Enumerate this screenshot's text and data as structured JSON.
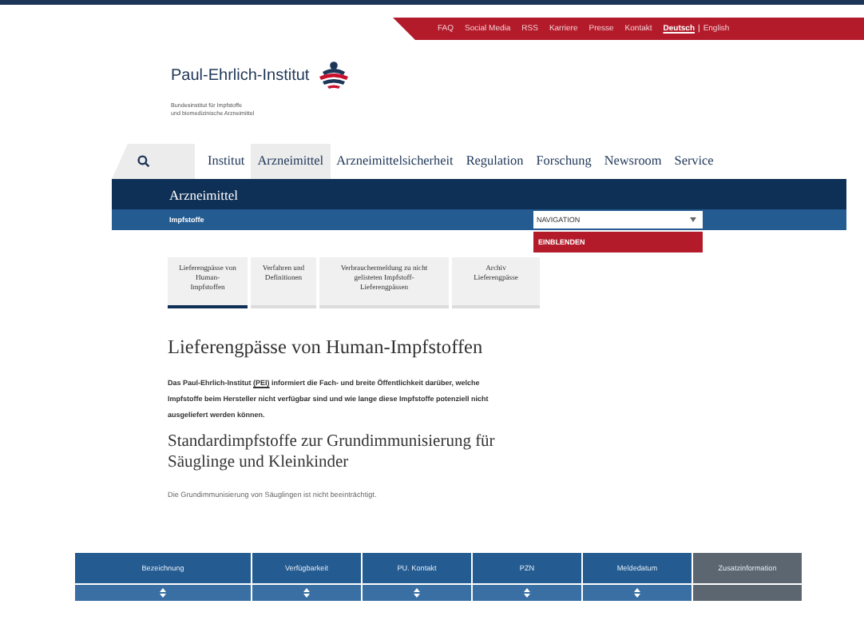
{
  "top_links": [
    {
      "label": "FAQ"
    },
    {
      "label": "Social Media"
    },
    {
      "label": "RSS"
    },
    {
      "label": "Karriere"
    },
    {
      "label": "Presse"
    },
    {
      "label": "Kontakt"
    }
  ],
  "languages": [
    {
      "label": "Deutsch",
      "selected": true
    },
    {
      "label": "English",
      "selected": false
    }
  ],
  "language_separator": "|",
  "logo": {
    "name": "Paul-Ehrlich-Institut",
    "subtitle_lines": [
      "Bundesinstitut für Impfstoffe",
      "und biomedizinische Arzneimittel"
    ]
  },
  "main_nav": [
    {
      "label": "Institut",
      "selected": false
    },
    {
      "label": "Arzneimittel",
      "selected": true
    },
    {
      "label": "Arzneimittelsicherheit",
      "selected": false
    },
    {
      "label": "Regulation",
      "selected": false
    },
    {
      "label": "Forschung",
      "selected": false
    },
    {
      "label": "Newsroom",
      "selected": false
    },
    {
      "label": "Service",
      "selected": false
    }
  ],
  "section_title": "Arzneimittel",
  "subsection": "Impfstoffe",
  "navigation_select": {
    "value": "NAVIGATION",
    "button": "EINBLENDEN"
  },
  "tabs": [
    {
      "label": "Lieferengpässe von Human-Impfstoffen",
      "selected": true
    },
    {
      "label": "Verfahren und Definitionen",
      "selected": false
    },
    {
      "label": "Verbrauchermeldung zu nicht gelisteten Impfstoff-Lieferengpässen",
      "selected": false
    },
    {
      "label": "Archiv Lieferengpässe",
      "selected": false
    }
  ],
  "heading": "Lieferengpässe von Human-Impfstoffen",
  "intro": {
    "before": "Das Paul-Ehrlich-Institut ",
    "link": "(PEI)",
    "after": " informiert die Fach- und breite Öffentlichkeit darüber, welche Impfstoffe beim Hersteller nicht verfügbar sind und wie lange diese Impfstoffe potenziell nicht ausgeliefert werden können."
  },
  "subheading": "Standardimpfstoffe zur Grundimmunisierung für Säuglinge und Kleinkinder",
  "note": "Die Grundimmunisierung von Säuglingen ist nicht beeinträchtigt.",
  "table": {
    "columns": [
      {
        "label": "Bezeichnung",
        "sortable": true
      },
      {
        "label": "Verfügbarkeit",
        "sortable": true
      },
      {
        "label": "PU. Kontakt",
        "sortable": true
      },
      {
        "label": "PZN",
        "sortable": true
      },
      {
        "label": "Meldedatum",
        "sortable": true
      },
      {
        "label": "Zusatzinformation",
        "sortable": false
      }
    ]
  }
}
